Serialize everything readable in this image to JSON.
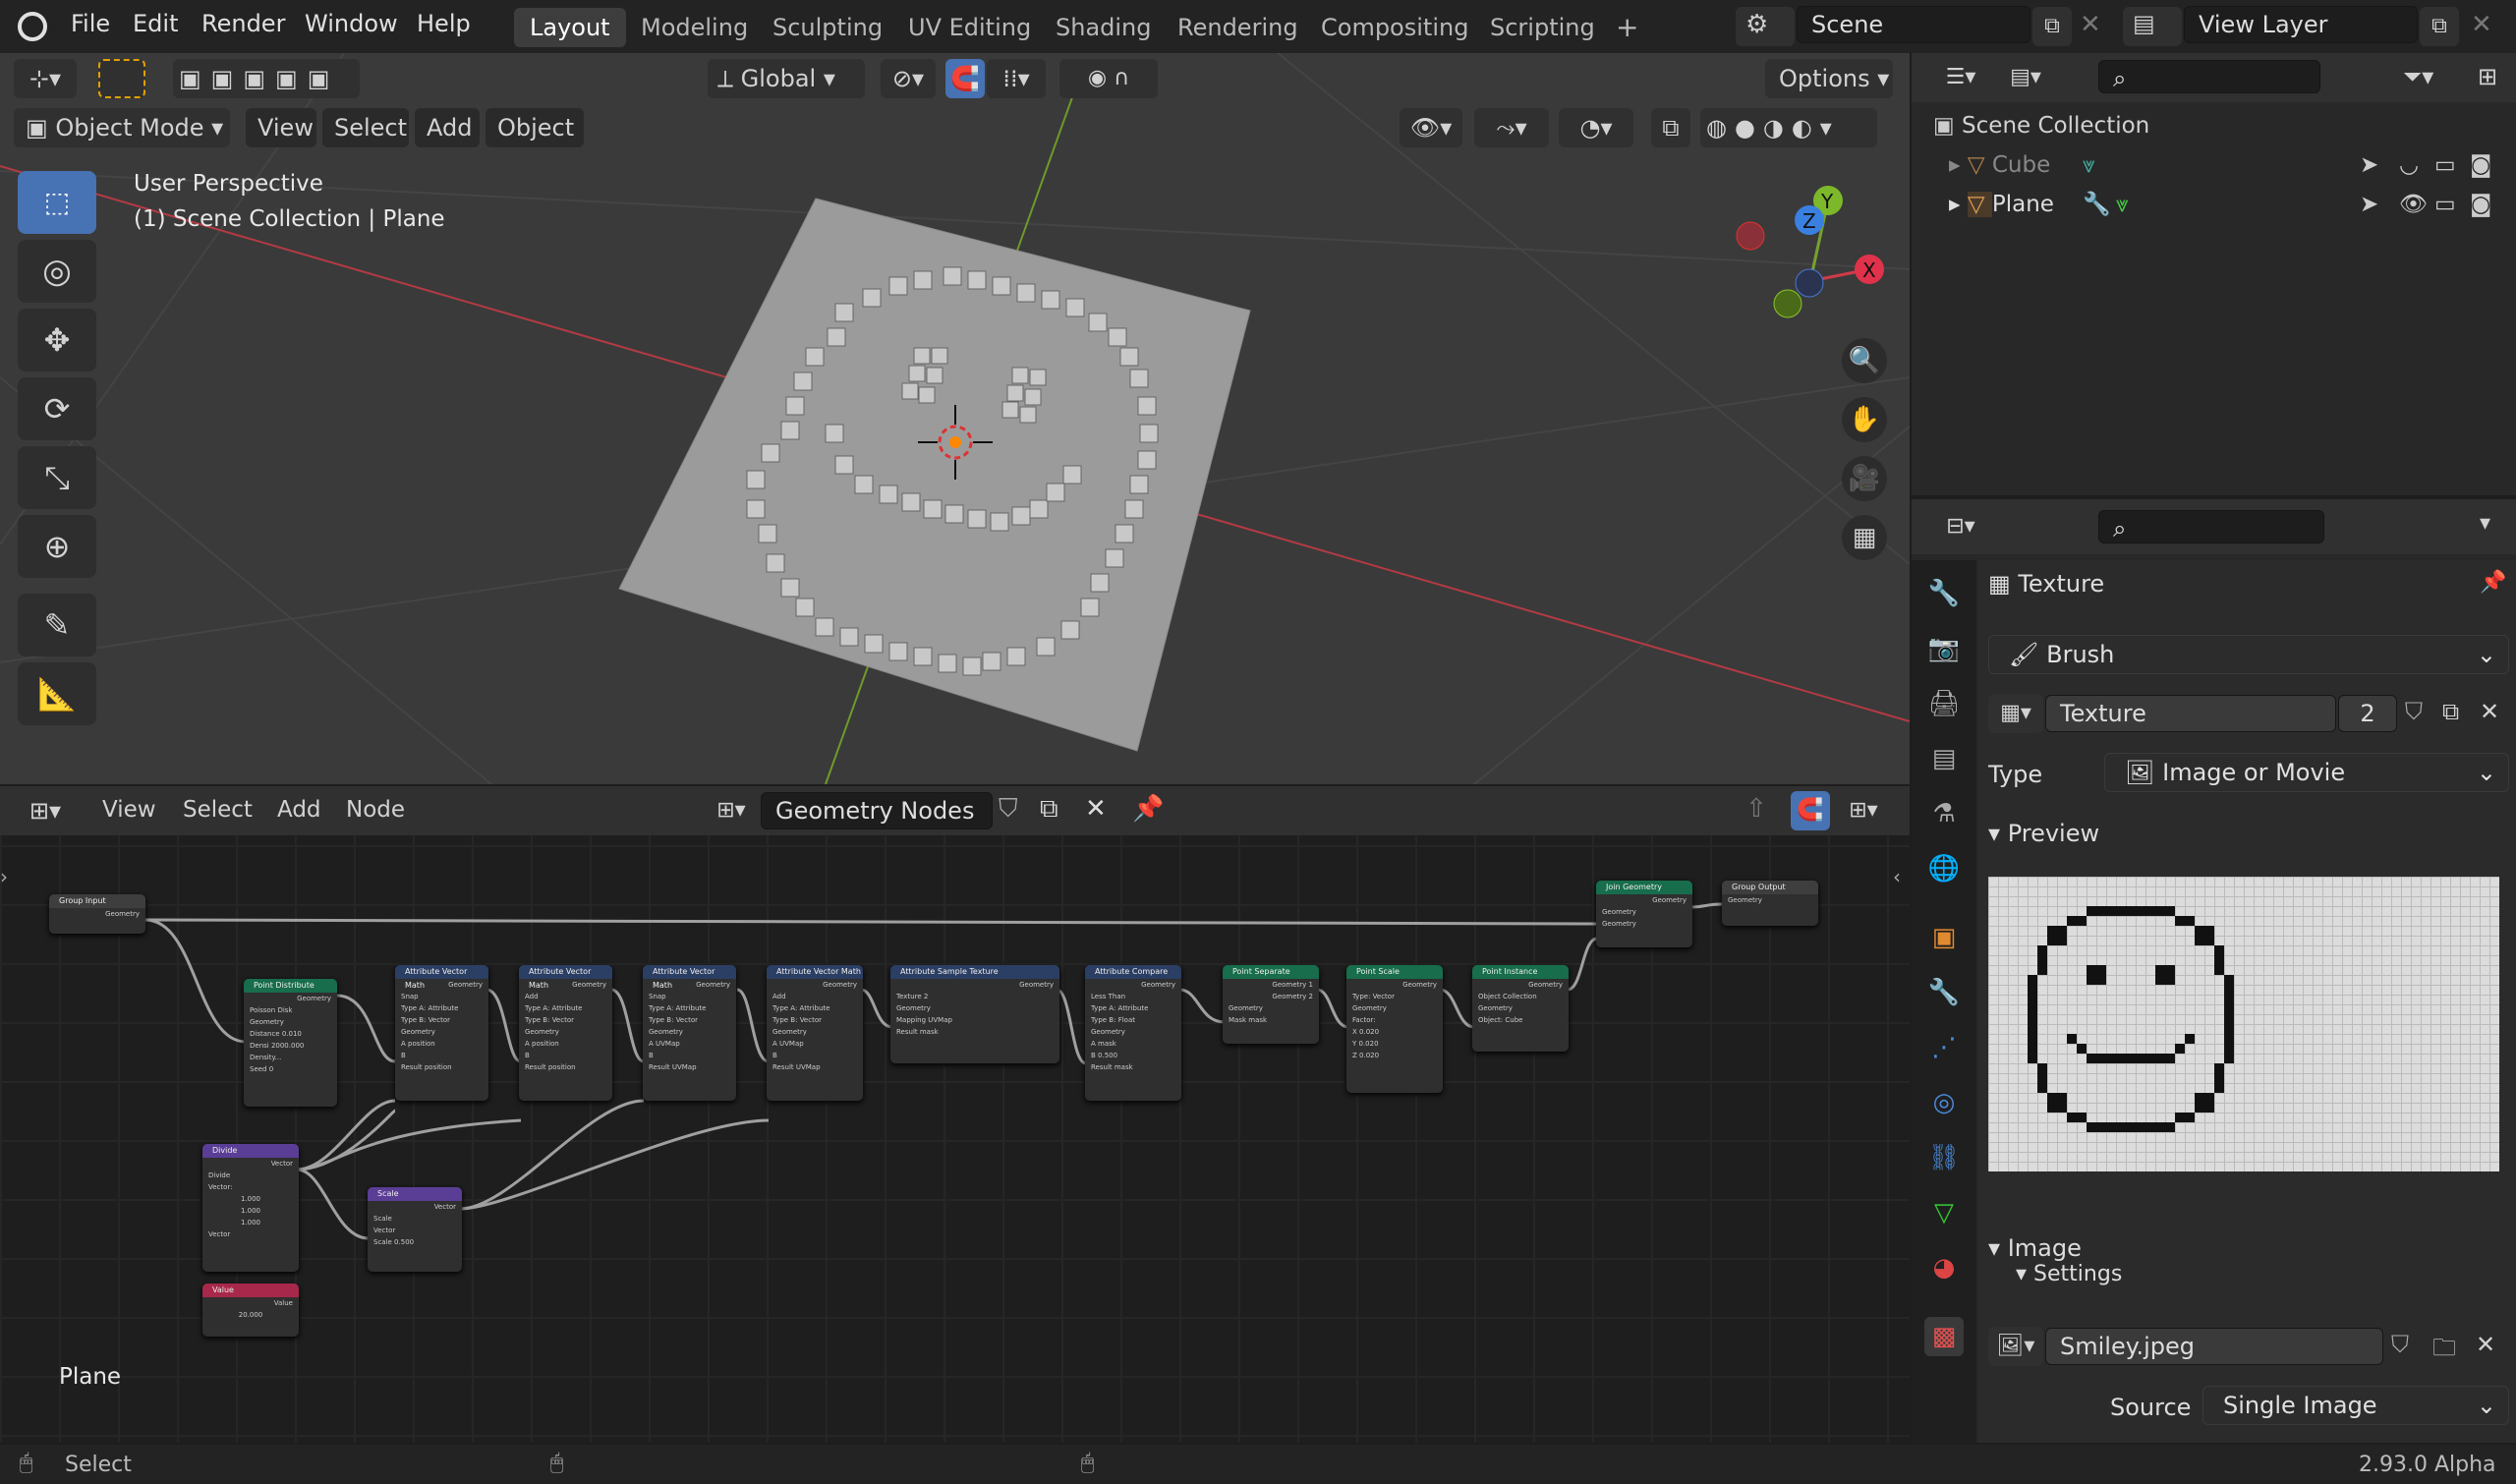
{
  "topbar": {
    "menus": [
      "File",
      "Edit",
      "Render",
      "Window",
      "Help"
    ],
    "workspaces": [
      "Layout",
      "Modeling",
      "Sculpting",
      "UV Editing",
      "Shading",
      "Rendering",
      "Compositing",
      "Scripting"
    ],
    "active_workspace": "Layout",
    "add_tab": "+",
    "scene": "Scene",
    "view_layer": "View Layer"
  },
  "viewport": {
    "orientation": "Global",
    "options": "Options",
    "mode": "Object Mode",
    "menus": [
      "View",
      "Select",
      "Add",
      "Object"
    ],
    "info_line1": "User Perspective",
    "info_line2": "(1) Scene Collection | Plane",
    "gizmo_labels": [
      "X",
      "Y",
      "Z"
    ]
  },
  "node_editor": {
    "menus": [
      "View",
      "Select",
      "Add",
      "Node"
    ],
    "tree_name": "Geometry Nodes",
    "object_label": "Plane",
    "nodes": [
      {
        "title": "Group Input",
        "color": "grey",
        "lines": [
          "Geometry"
        ]
      },
      {
        "title": "Point Distribute",
        "color": "green",
        "lines": [
          "Geometry",
          "Poisson Disk",
          "Geometry",
          "Distance 0.010",
          "Densi 2000.000",
          "Density...",
          "Seed 0"
        ]
      },
      {
        "title": "Attribute Vector Math",
        "color": "blue",
        "lines": [
          "Geometry",
          "Snap",
          "Type A: Attribute",
          "Type B: Vector",
          "Geometry",
          "A position",
          "B",
          "Result position"
        ]
      },
      {
        "title": "Attribute Vector Math",
        "color": "blue",
        "lines": [
          "Geometry",
          "Add",
          "Type A: Attribute",
          "Type B: Vector",
          "Geometry",
          "A position",
          "B",
          "Result position"
        ]
      },
      {
        "title": "Attribute Vector Math",
        "color": "blue",
        "lines": [
          "Geometry",
          "Snap",
          "Type A: Attribute",
          "Type B: Vector",
          "Geometry",
          "A UVMap",
          "B",
          "Result UVMap"
        ]
      },
      {
        "title": "Attribute Vector Math",
        "color": "blue",
        "lines": [
          "Geometry",
          "Add",
          "Type A: Attribute",
          "Type B: Vector",
          "Geometry",
          "A UVMap",
          "B",
          "Result UVMap"
        ]
      },
      {
        "title": "Attribute Sample Texture",
        "color": "blue",
        "lines": [
          "Geometry",
          "Texture 2",
          "Geometry",
          "Mapping UVMap",
          "Result mask"
        ]
      },
      {
        "title": "Attribute Compare",
        "color": "blue",
        "lines": [
          "Geometry",
          "Less Than",
          "Type A: Attribute",
          "Type B: Float",
          "Geometry",
          "A mask",
          "B 0.500",
          "Result mask"
        ]
      },
      {
        "title": "Point Separate",
        "color": "green",
        "lines": [
          "Geometry 1",
          "Geometry 2",
          "Geometry",
          "Mask mask"
        ]
      },
      {
        "title": "Point Scale",
        "color": "green",
        "lines": [
          "Geometry",
          "Type: Vector",
          "Geometry",
          "Factor:",
          "X 0.020",
          "Y 0.020",
          "Z 0.020"
        ]
      },
      {
        "title": "Point Instance",
        "color": "green",
        "lines": [
          "Geometry",
          "Object Collection",
          "Geometry",
          "Object: Cube"
        ]
      },
      {
        "title": "Join Geometry",
        "color": "green",
        "lines": [
          "Geometry",
          "Geometry",
          "Geometry"
        ]
      },
      {
        "title": "Group Output",
        "color": "grey",
        "lines": [
          "Geometry"
        ]
      },
      {
        "title": "Divide",
        "color": "purple",
        "lines": [
          "Vector",
          "Divide",
          "Vector:",
          "1.000",
          "1.000",
          "1.000",
          "Vector"
        ]
      },
      {
        "title": "Scale",
        "color": "purple",
        "lines": [
          "Vector",
          "Scale",
          "Vector",
          "Scale 0.500"
        ]
      },
      {
        "title": "Value",
        "color": "red",
        "lines": [
          "Value",
          "20.000"
        ]
      }
    ]
  },
  "outliner": {
    "root": "Scene Collection",
    "items": [
      {
        "name": "Cube",
        "dim": true
      },
      {
        "name": "Plane",
        "dim": false
      }
    ]
  },
  "properties": {
    "header": "Texture",
    "context": "Brush",
    "texture_name": "Texture",
    "users": "2",
    "type_label": "Type",
    "type_value": "Image or Movie",
    "preview_label": "Preview",
    "image_label": "Image",
    "settings_label": "Settings",
    "image_name": "Smiley.jpeg",
    "source_label": "Source",
    "source_value": "Single Image"
  },
  "statusbar": {
    "left": "Select",
    "version": "2.93.0 Alpha"
  }
}
